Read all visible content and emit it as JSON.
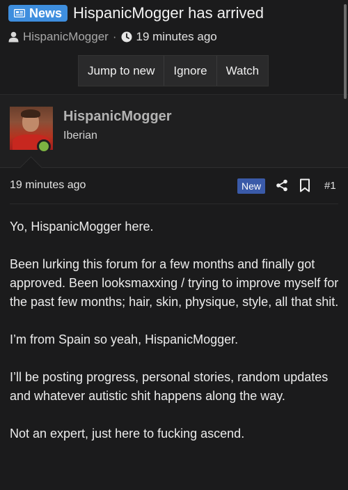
{
  "thread": {
    "badge_label": "News",
    "title": "HispanicMogger has arrived",
    "author": "HispanicMogger",
    "meta_sep": "·",
    "age": "19 minutes ago"
  },
  "actions": {
    "jump_label": "Jump to new",
    "ignore_label": "Ignore",
    "watch_label": "Watch"
  },
  "author_card": {
    "username": "HispanicMogger",
    "user_title": "Iberian",
    "online_status_color": "#7cb342"
  },
  "post": {
    "time": "19 minutes ago",
    "new_label": "New",
    "number": "#1",
    "paragraphs": [
      "Yo, HispanicMogger here.",
      "Been lurking this forum for a few months and finally got approved. Been looksmaxxing / trying to improve myself for the past few months; hair, skin, physique, style, all that shit.",
      "I’m from Spain so yeah, HispanicMogger.",
      "I’ll be posting progress, personal stories, random updates and whatever autistic shit happens along the way.",
      "Not an expert, just here to fucking ascend."
    ]
  },
  "icons": {
    "badge": "news-icon",
    "user": "user-icon",
    "clock": "clock-icon",
    "share": "share-icon",
    "bookmark": "bookmark-icon"
  },
  "colors": {
    "accent": "#3e8ede",
    "new_badge": "#3a5aa8",
    "background": "#1b1b1c"
  }
}
